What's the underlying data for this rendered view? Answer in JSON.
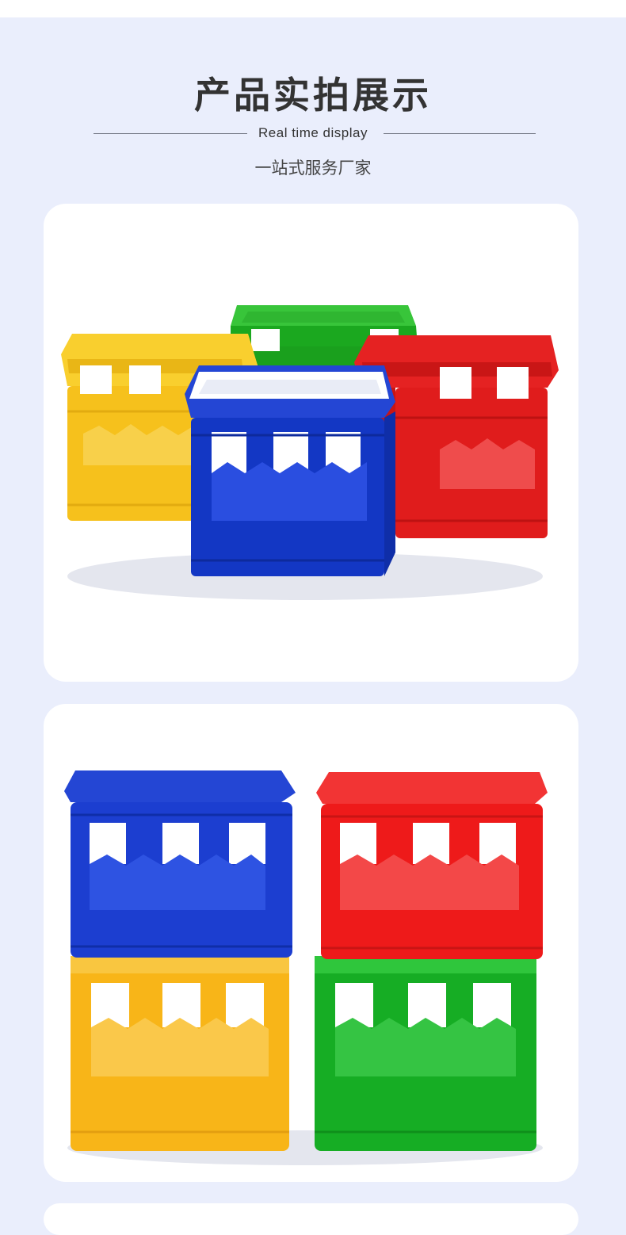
{
  "header": {
    "title": "产品实拍展示",
    "subtitle_en": "Real time display",
    "subtitle_cn": "一站式服务厂家"
  },
  "photos": [
    {
      "subject": "four plastic bottle crates arranged in a group",
      "crate_colors": [
        "#f5c21b",
        "#1ba81f",
        "#d81414",
        "#1337c4"
      ]
    },
    {
      "subject": "four plastic bottle crates stacked in two columns",
      "crate_colors": [
        "#1c3ed0",
        "#ee1a1a",
        "#f8b518",
        "#16ad24"
      ]
    }
  ]
}
